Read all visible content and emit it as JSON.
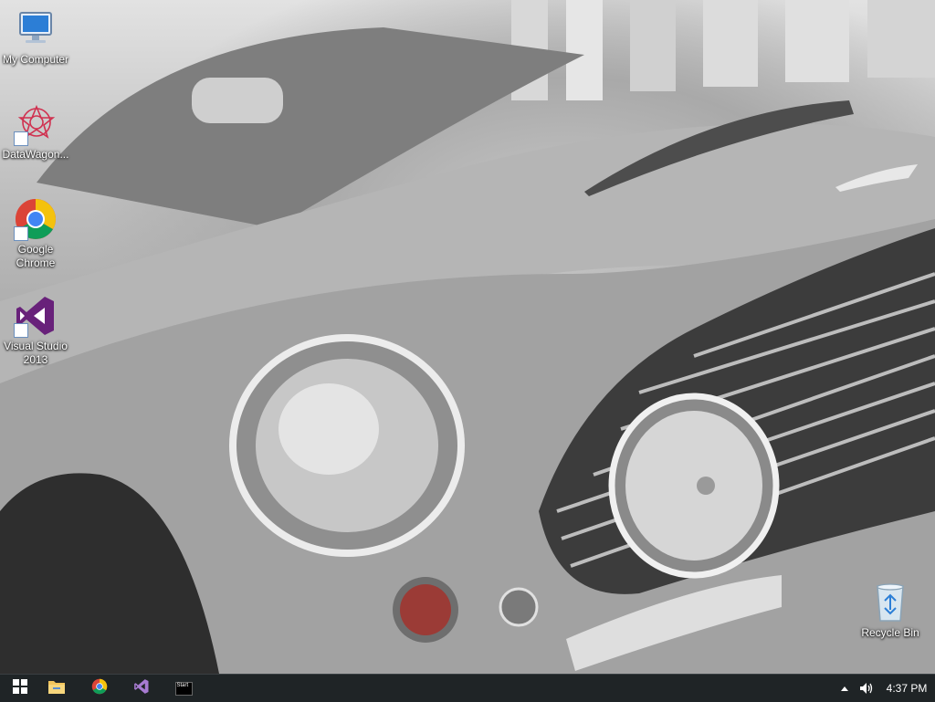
{
  "desktop": {
    "icons": [
      {
        "label": "My Computer",
        "icon": "computer-icon"
      },
      {
        "label": "DataWagon...",
        "icon": "datawagon-icon"
      },
      {
        "label": "Google Chrome",
        "icon": "chrome-icon"
      },
      {
        "label": "Visual Studio 2013",
        "icon": "visual-studio-icon"
      },
      {
        "label": "Recycle Bin",
        "icon": "recycle-bin-icon"
      }
    ]
  },
  "taskbar": {
    "pinned": [
      {
        "icon": "windows-start-icon"
      },
      {
        "icon": "file-explorer-icon"
      },
      {
        "icon": "chrome-icon"
      },
      {
        "icon": "visual-studio-icon"
      },
      {
        "icon": "start-app-icon",
        "label": "Start"
      }
    ],
    "tray": {
      "chevron_icon": "chevron-up-icon",
      "volume_icon": "speaker-icon",
      "time": "4:37 PM"
    }
  },
  "colors": {
    "taskbar_bg": "#1f2426",
    "visual_studio": "#68217a",
    "chrome_red": "#db4437",
    "chrome_yellow": "#f4c20d",
    "chrome_green": "#0f9d58",
    "chrome_blue": "#4285f4"
  }
}
